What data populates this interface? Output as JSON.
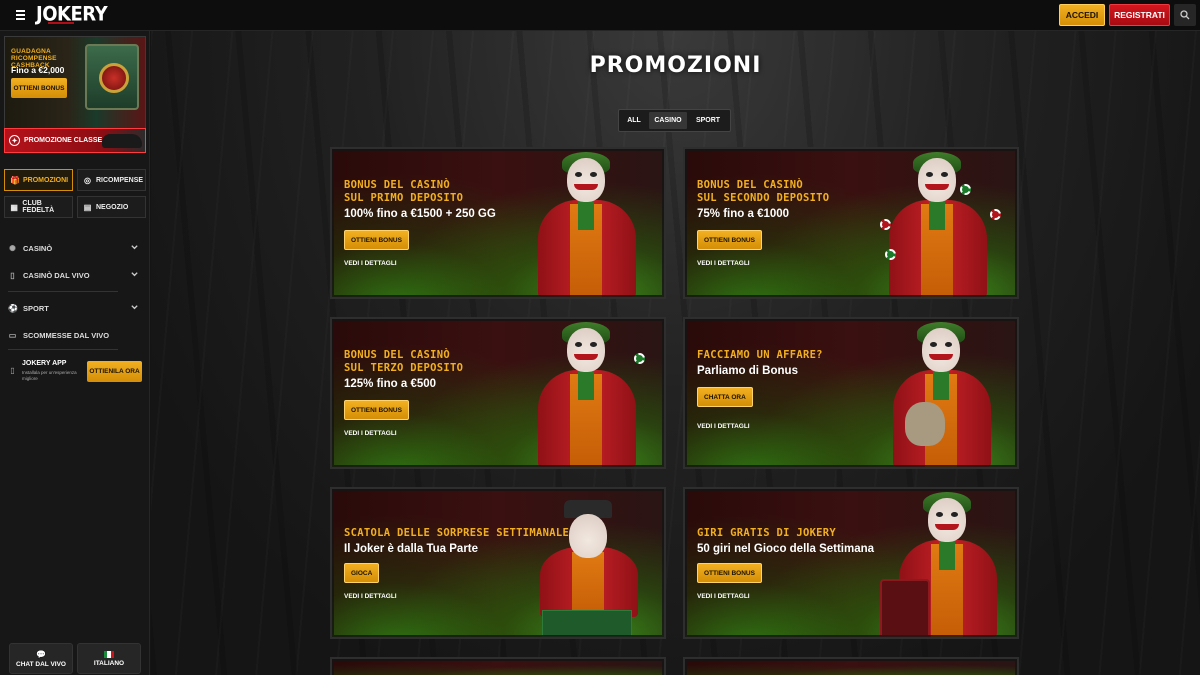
{
  "header": {
    "logo": "JOKERY",
    "login_label": "ACCEDI",
    "register_label": "REGISTRATI"
  },
  "sidebar": {
    "promo_cashback": {
      "title": "GUADAGNA RICOMPENSE CASHBACK",
      "amount": "Fino a €2,000",
      "button": "OTTIENI BONUS"
    },
    "promo_g": "PROMOZIONE CLASSE G",
    "nav": [
      {
        "label": "PROMOZIONI",
        "icon": "gift-icon"
      },
      {
        "label": "RICOMPENSE",
        "icon": "chip-icon"
      },
      {
        "label": "CLUB FEDELTÀ",
        "icon": "club-icon"
      },
      {
        "label": "NEGOZIO",
        "icon": "shop-icon"
      }
    ],
    "sections": [
      {
        "label": "CASINÒ",
        "icon": "casino-icon"
      },
      {
        "label": "CASINÒ DAL VIVO",
        "icon": "cards-icon"
      },
      {
        "label": "SPORT",
        "icon": "sport-icon"
      },
      {
        "label": "SCOMMESSE DAL VIVO",
        "icon": "live-bet-icon"
      }
    ],
    "app": {
      "title": "JOKERY APP",
      "subtitle": "Installala per un'esperienza migliore",
      "button": "OTTIENILA ORA"
    },
    "bottom": {
      "chat": "CHAT DAL VIVO",
      "language": "ITALIANO"
    }
  },
  "main": {
    "title": "PROMOZIONI",
    "filters": [
      "ALL",
      "CASINO",
      "SPORT"
    ],
    "active_filter": "CASINO",
    "cards": [
      {
        "headline": "BONUS DEL CASINÒ\nSUL PRIMO DEPOSITO",
        "offer": "100% fino a €1500 + 250 GG",
        "button": "OTTIENI BONUS",
        "details": "VEDI I DETTAGLI"
      },
      {
        "headline": "BONUS DEL CASINÒ\nSUL SECONDO DEPOSITO",
        "offer": "75% fino a €1000",
        "button": "OTTIENI BONUS",
        "details": "VEDI I DETTAGLI"
      },
      {
        "headline": "BONUS DEL CASINÒ\nSUL TERZO DEPOSITO",
        "offer": "125% fino a €500",
        "button": "OTTIENI BONUS",
        "details": "VEDI I DETTAGLI"
      },
      {
        "headline": "FACCIAMO UN AFFARE?",
        "offer": "Parliamo di Bonus",
        "button": "CHATTA ORA",
        "details": "VEDI I DETTAGLI"
      },
      {
        "headline": "SCATOLA DELLE SORPRESE SETTIMANALE",
        "offer": "Il Joker è dalla Tua Parte",
        "button": "GIOCA",
        "details": "VEDI I DETTAGLI"
      },
      {
        "headline": "GIRI GRATIS DI JOKERY",
        "offer": "50 giri nel Gioco della Settimana",
        "button": "OTTIENI BONUS",
        "details": "VEDI I DETTAGLI"
      }
    ]
  },
  "colors": {
    "accent_gold": "#f2b021",
    "accent_red": "#c8151d",
    "background": "#141414"
  }
}
